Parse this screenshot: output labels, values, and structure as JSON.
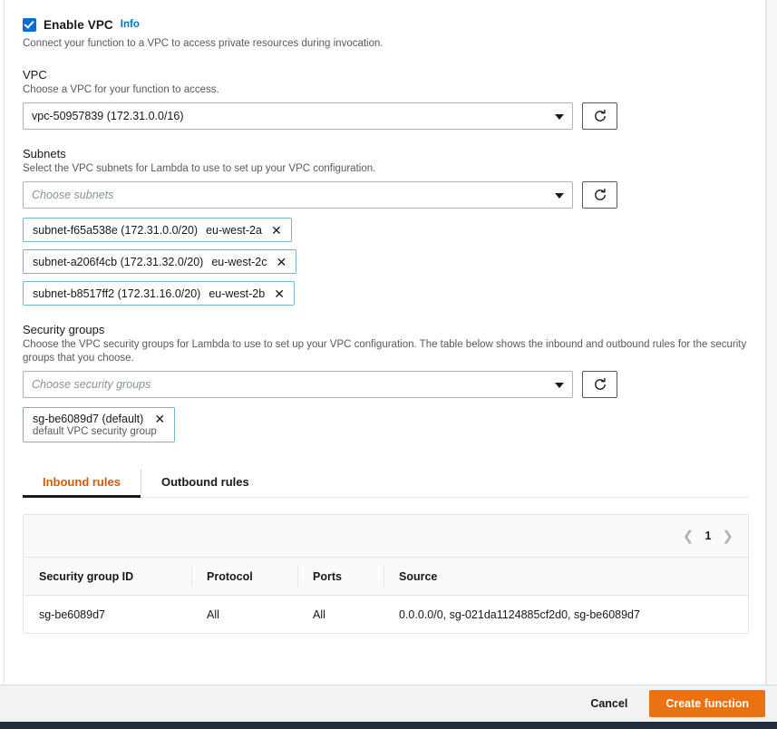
{
  "enable_vpc": {
    "label": "Enable VPC",
    "info_label": "Info",
    "checked": true,
    "description": "Connect your function to a VPC to access private resources during invocation."
  },
  "vpc": {
    "label": "VPC",
    "description": "Choose a VPC for your function to access.",
    "selected": "vpc-50957839 (172.31.0.0/16)",
    "refresh_icon": "refresh-icon",
    "caret_icon": "chevron-down-icon"
  },
  "subnets": {
    "label": "Subnets",
    "description": "Select the VPC subnets for Lambda to use to set up your VPC configuration.",
    "placeholder": "Choose subnets",
    "refresh_icon": "refresh-icon",
    "caret_icon": "chevron-down-icon",
    "tags": [
      {
        "main": "subnet-f65a538e (172.31.0.0/20)",
        "az": "eu-west-2a",
        "remove_icon": "close-icon"
      },
      {
        "main": "subnet-a206f4cb (172.31.32.0/20)",
        "az": "eu-west-2c",
        "remove_icon": "close-icon"
      },
      {
        "main": "subnet-b8517ff2 (172.31.16.0/20)",
        "az": "eu-west-2b",
        "remove_icon": "close-icon"
      }
    ]
  },
  "security_groups": {
    "label": "Security groups",
    "description": "Choose the VPC security groups for Lambda to use to set up your VPC configuration. The table below shows the inbound and outbound rules for the security groups that you choose.",
    "placeholder": "Choose security groups",
    "refresh_icon": "refresh-icon",
    "caret_icon": "chevron-down-icon",
    "tags": [
      {
        "main": "sg-be6089d7 (default)",
        "sub": "default VPC security group",
        "remove_icon": "close-icon"
      }
    ]
  },
  "rules": {
    "tabs": [
      {
        "label": "Inbound rules",
        "active": true
      },
      {
        "label": "Outbound rules",
        "active": false
      }
    ],
    "pagination": {
      "prev_icon": "chevron-left-icon",
      "page": "1",
      "next_icon": "chevron-right-icon"
    },
    "columns": [
      "Security group ID",
      "Protocol",
      "Ports",
      "Source"
    ],
    "rows": [
      {
        "security_group_id": "sg-be6089d7",
        "protocol": "All",
        "ports": "All",
        "source": "0.0.0.0/0, sg-021da1124885cf2d0, sg-be6089d7"
      }
    ]
  },
  "footer": {
    "cancel_label": "Cancel",
    "create_label": "Create function"
  },
  "colors": {
    "accent_orange": "#ec7211",
    "active_tab": "#d45b07",
    "link_blue": "#0073bb",
    "checkbox_blue": "#0a6ed1",
    "tag_border": "#72b8d2",
    "bottom_bar": "#232f3e"
  }
}
